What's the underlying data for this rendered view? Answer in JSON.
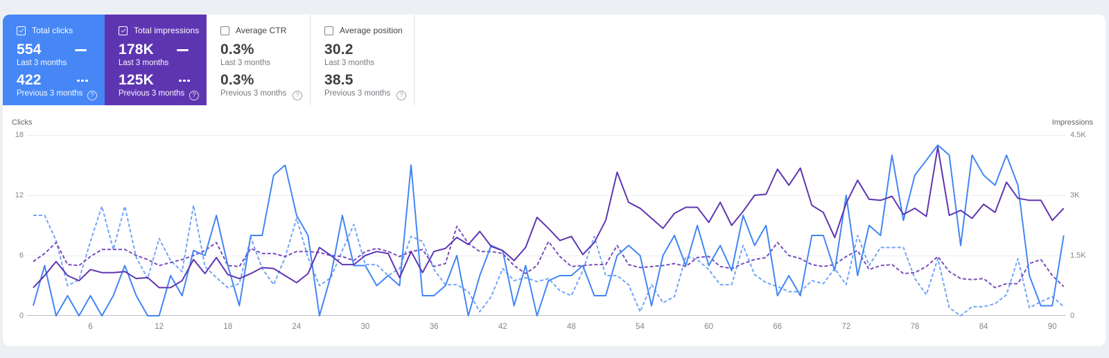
{
  "metric_cards": [
    {
      "id": "total-clicks",
      "label": "Total clicks",
      "checked": true,
      "bg": "#4687f5",
      "primary_value": "554",
      "primary_caption": "Last 3 months",
      "secondary_value": "422",
      "secondary_caption": "Previous 3 months"
    },
    {
      "id": "total-impressions",
      "label": "Total impressions",
      "checked": true,
      "bg": "#5e35b1",
      "primary_value": "178K",
      "primary_caption": "Last 3 months",
      "secondary_value": "125K",
      "secondary_caption": "Previous 3 months"
    },
    {
      "id": "average-ctr",
      "label": "Average CTR",
      "checked": false,
      "bg": "#ffffff",
      "primary_value": "0.3%",
      "primary_caption": "Last 3 months",
      "secondary_value": "0.3%",
      "secondary_caption": "Previous 3 months"
    },
    {
      "id": "average-position",
      "label": "Average position",
      "checked": false,
      "bg": "#ffffff",
      "primary_value": "30.2",
      "primary_caption": "Last 3 months",
      "secondary_value": "38.5",
      "secondary_caption": "Previous 3 months"
    }
  ],
  "help_icon": "?",
  "chart_data": {
    "type": "line",
    "x_start": 1,
    "x_end": 91,
    "x_ticks": [
      6,
      12,
      18,
      24,
      30,
      36,
      42,
      48,
      54,
      60,
      66,
      72,
      78,
      84,
      90
    ],
    "left_axis": {
      "label": "Clicks",
      "max": 18,
      "ticks": [
        "18",
        "12",
        "6",
        "0"
      ]
    },
    "right_axis": {
      "label": "Impressions",
      "max": 4500,
      "ticks": [
        "4.5K",
        "3K",
        "1.5K",
        "0"
      ]
    },
    "grid": "horizontal-only",
    "series": [
      {
        "id": "clicks-previous",
        "name": "Clicks – Previous 3 months",
        "axis": "left",
        "style": "dashed",
        "color": "#71a4f7",
        "values": [
          10,
          10,
          7.5,
          3,
          3.6,
          7.4,
          10.9,
          6.6,
          10.9,
          5.8,
          3.7,
          7.7,
          5.5,
          4.4,
          11,
          4.9,
          3.8,
          2.8,
          3.2,
          7.8,
          4.7,
          3.1,
          5.8,
          9.7,
          5.8,
          3,
          3.8,
          6.5,
          9.1,
          5.1,
          5.1,
          4,
          4.7,
          7.9,
          7.4,
          4.6,
          3.1,
          3.1,
          2.4,
          0.4,
          1.9,
          4.7,
          3.5,
          3.8,
          3.4,
          3.7,
          2.5,
          2,
          4.5,
          7.9,
          4,
          4,
          3.1,
          0.4,
          3.1,
          1.3,
          1.9,
          5.9,
          5.6,
          4.6,
          3.1,
          3.1,
          7,
          4.1,
          3.3,
          2.9,
          2.4,
          2.4,
          3.5,
          3.2,
          4.7,
          3.1,
          8,
          5,
          6.8,
          6.8,
          6.8,
          3.7,
          2.1,
          5.7,
          0.8,
          0,
          0.9,
          0.9,
          1.2,
          2.1,
          5.7,
          0.8,
          1.4,
          1.9,
          0.9
        ]
      },
      {
        "id": "impressions-previous",
        "name": "Impressions – Previous 3 months",
        "axis": "right",
        "style": "dashed",
        "color": "#774cbd",
        "values": [
          1350,
          1550,
          1825,
          1275,
          1250,
          1475,
          1650,
          1650,
          1650,
          1500,
          1400,
          1250,
          1325,
          1400,
          1500,
          1625,
          1825,
          1250,
          1225,
          1675,
          1550,
          1550,
          1475,
          1600,
          1600,
          1575,
          1500,
          1475,
          1375,
          1600,
          1675,
          1600,
          1475,
          1600,
          1650,
          1225,
          1300,
          2225,
          1800,
          1600,
          1600,
          1550,
          1250,
          1050,
          1250,
          1850,
          1475,
          1225,
          1250,
          1275,
          1275,
          1750,
          1275,
          1200,
          1225,
          1250,
          1300,
          1225,
          1450,
          1475,
          1225,
          1175,
          1300,
          1400,
          1450,
          1825,
          1500,
          1425,
          1275,
          1225,
          1275,
          1475,
          1625,
          1150,
          1250,
          1275,
          1050,
          1075,
          1225,
          1475,
          1100,
          925,
          900,
          925,
          700,
          800,
          800,
          1300,
          1400,
          1000,
          725
        ]
      },
      {
        "id": "clicks-current",
        "name": "Clicks – Last 3 months",
        "axis": "left",
        "style": "solid",
        "color": "#4285f4",
        "values": [
          1,
          5,
          0,
          2,
          0,
          2,
          0,
          2,
          5,
          2,
          0,
          0,
          4,
          2,
          6.5,
          6,
          10,
          5,
          1,
          8,
          8,
          14,
          15,
          10,
          8,
          0,
          4,
          10,
          5,
          5,
          3,
          4,
          3,
          15,
          2,
          2,
          3,
          6,
          0,
          4,
          7,
          6.5,
          1,
          5,
          0,
          3.5,
          4,
          4,
          5,
          2,
          2,
          6,
          7,
          6,
          1,
          6,
          8,
          5,
          9,
          5,
          7,
          4.5,
          10,
          7,
          9,
          2,
          4,
          2,
          8,
          8,
          4.5,
          12,
          4,
          9,
          8,
          16,
          9.5,
          14,
          15.5,
          17,
          16,
          7,
          16,
          14,
          13,
          16,
          13,
          4,
          1,
          1,
          8
        ]
      },
      {
        "id": "impressions-current",
        "name": "Impressions – Last 3 months",
        "axis": "right",
        "style": "solid",
        "color": "#5e35b1",
        "values": [
          700,
          1000,
          1350,
          1000,
          875,
          1150,
          1075,
          1075,
          1100,
          925,
          950,
          700,
          700,
          875,
          1400,
          1050,
          1450,
          1025,
          925,
          1050,
          1200,
          1175,
          1000,
          825,
          1050,
          1700,
          1500,
          1275,
          1275,
          1500,
          1600,
          1550,
          950,
          1600,
          1075,
          1600,
          1675,
          1950,
          1775,
          2100,
          1725,
          1625,
          1375,
          1700,
          2450,
          2175,
          1875,
          1975,
          1525,
          1825,
          2375,
          3575,
          2825,
          2675,
          2425,
          2175,
          2550,
          2700,
          2700,
          2325,
          2825,
          2250,
          2600,
          3000,
          3025,
          3650,
          3250,
          3675,
          2750,
          2575,
          1950,
          2800,
          3375,
          2900,
          2875,
          2975,
          2525,
          2675,
          2475,
          4200,
          2500,
          2625,
          2425,
          2775,
          2575,
          3325,
          2925,
          2875,
          2875,
          2375,
          2675
        ]
      }
    ]
  }
}
